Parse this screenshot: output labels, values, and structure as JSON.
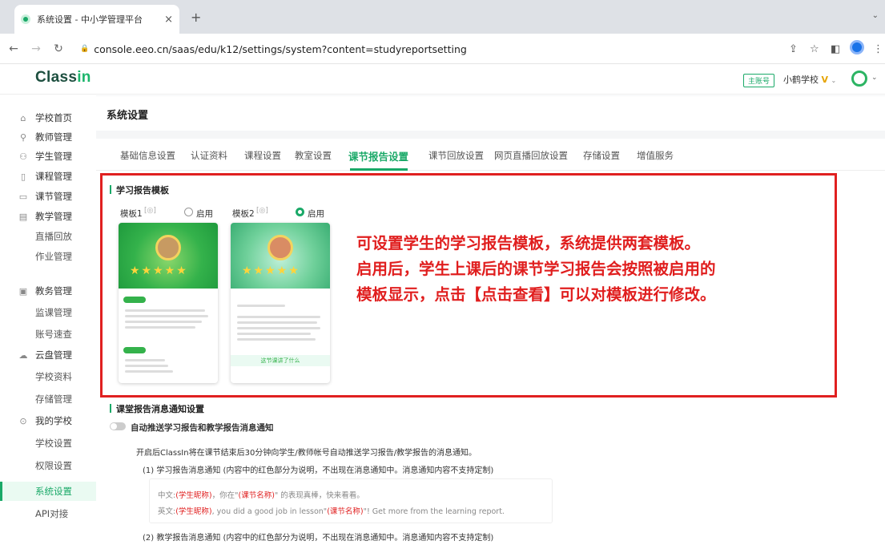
{
  "browser": {
    "tab_title": "系统设置 - 中小学管理平台",
    "url": "console.eeo.cn/saas/edu/k12/settings/system?content=studyreportsetting"
  },
  "header": {
    "logo_part1": "Class",
    "logo_part2": "in",
    "account_badge": "主账号",
    "school_name": "小鹤学校",
    "vip_mark": "V"
  },
  "sidebar": {
    "items": [
      {
        "label": "学校首页",
        "icon": "home-icon"
      },
      {
        "label": "教师管理",
        "icon": "person-icon"
      },
      {
        "label": "学生管理",
        "icon": "student-icon"
      },
      {
        "label": "课程管理",
        "icon": "course-icon"
      },
      {
        "label": "课节管理",
        "icon": "lesson-icon"
      },
      {
        "label": "教学管理",
        "icon": "teaching-icon"
      },
      {
        "label": "直播回放"
      },
      {
        "label": "作业管理"
      },
      {
        "label": "教务管理",
        "icon": "affairs-icon"
      },
      {
        "label": "监课管理"
      },
      {
        "label": "账号速查"
      },
      {
        "label": "云盘管理",
        "icon": "cloud-icon"
      },
      {
        "label": "学校资料"
      },
      {
        "label": "存储管理"
      },
      {
        "label": "我的学校",
        "icon": "school-icon"
      },
      {
        "label": "学校设置"
      },
      {
        "label": "权限设置"
      },
      {
        "label": "系统设置"
      },
      {
        "label": "API对接"
      }
    ]
  },
  "page": {
    "title": "系统设置",
    "tabs": [
      "基础信息设置",
      "认证资料",
      "课程设置",
      "教室设置",
      "课节报告设置",
      "课节回放设置",
      "网页直播回放设置",
      "存储设置",
      "增值服务"
    ]
  },
  "report_template": {
    "heading": "学习报告模板",
    "template1_label": "模板1",
    "template2_label": "模板2",
    "enable_label": "启用",
    "card1_section1": "教师评语",
    "card1_section2": "课节回顾",
    "card2_link": "这节课讲了什么"
  },
  "annotation": {
    "line1": "可设置学生的学习报告模板，系统提供两套模板。",
    "line2": "启用后，学生上课后的课节学习报告会按照被启用的",
    "line3": "模板显示，点击【点击查看】可以对模板进行修改。"
  },
  "notification": {
    "heading": "课堂报告消息通知设置",
    "toggle_label": "自动推送学习报告和教学报告消息通知",
    "desc": "开启后ClassIn将在课节结束后30分钟向学生/教师帐号自动推送学习报告/教学报告的消息通知。",
    "item1": "(1) 学习报告消息通知 (内容中的红色部分为说明，不出现在消息通知中。消息通知内容不支持定制)",
    "cn_prefix": "中文:",
    "cn_red1": "(学生昵称)",
    "cn_mid": "，你在\"",
    "cn_red2": "(课节名称)",
    "cn_suffix": "\" 的表现真棒，快来看看。",
    "en_prefix": "英文:",
    "en_red1": "(学生昵称)",
    "en_mid": ", you did a good job in lesson\"",
    "en_red2": "(课节名称)",
    "en_suffix": "\"! Get more from the learning report.",
    "item2": "(2) 教学报告消息通知 (内容中的红色部分为说明，不出现在消息通知中。消息通知内容不支持定制)"
  },
  "colors": {
    "accent": "#1aa968",
    "highlight": "#e02020"
  }
}
